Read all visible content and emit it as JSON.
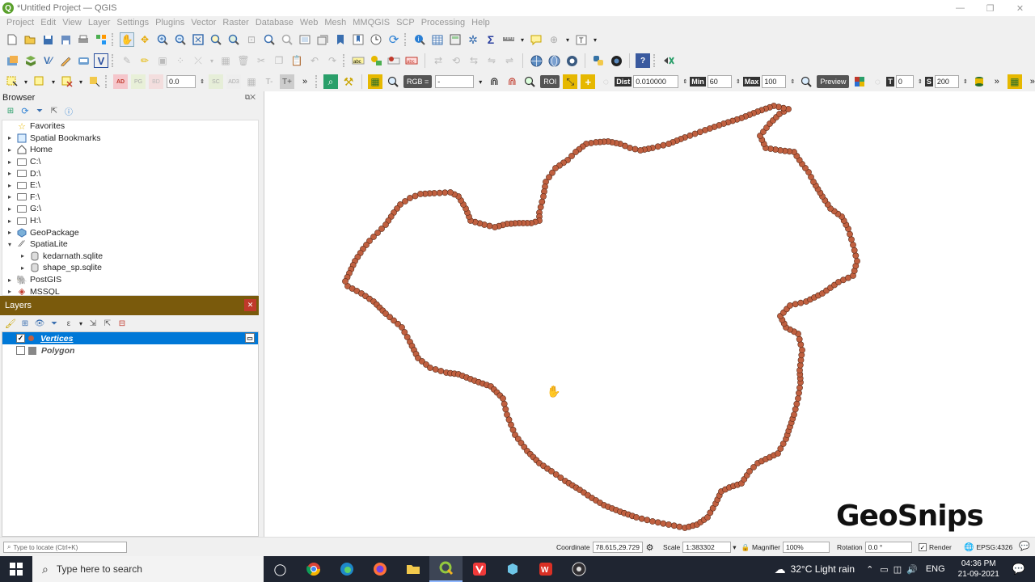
{
  "window": {
    "title": "*Untitled Project — QGIS",
    "app_letter": "Q"
  },
  "menu": [
    "Project",
    "Edit",
    "View",
    "Layer",
    "Settings",
    "Plugins",
    "Vector",
    "Raster",
    "Database",
    "Web",
    "Mesh",
    "MMQGIS",
    "SCP",
    "Processing",
    "Help"
  ],
  "toolbar3": {
    "field_value": "0.0",
    "rgb_label": "RGB =",
    "rgb_value": "-",
    "roi_label": "ROI",
    "dist_label": "Dist",
    "dist_value": "0.010000",
    "min_label": "Min",
    "min_value": "60",
    "max_label": "Max",
    "max_value": "100",
    "preview_label": "Preview",
    "t_label": "T",
    "t_value": "0",
    "s_label": "S",
    "s_value": "200"
  },
  "browser": {
    "title": "Browser",
    "items": [
      {
        "label": "Favorites",
        "icon": "star-icon",
        "arrow": "",
        "indent": 0
      },
      {
        "label": "Spatial Bookmarks",
        "icon": "bookmark-icon",
        "arrow": "▸",
        "indent": 0
      },
      {
        "label": "Home",
        "icon": "home-icon",
        "arrow": "▸",
        "indent": 0
      },
      {
        "label": "C:\\",
        "icon": "folder-icon",
        "arrow": "▸",
        "indent": 0
      },
      {
        "label": "D:\\",
        "icon": "folder-icon",
        "arrow": "▸",
        "indent": 0
      },
      {
        "label": "E:\\",
        "icon": "folder-icon",
        "arrow": "▸",
        "indent": 0
      },
      {
        "label": "F:\\",
        "icon": "folder-icon",
        "arrow": "▸",
        "indent": 0
      },
      {
        "label": "G:\\",
        "icon": "folder-icon",
        "arrow": "▸",
        "indent": 0
      },
      {
        "label": "H:\\",
        "icon": "folder-icon",
        "arrow": "▸",
        "indent": 0
      },
      {
        "label": "GeoPackage",
        "icon": "geopackage-icon",
        "arrow": "▸",
        "indent": 0
      },
      {
        "label": "SpatiaLite",
        "icon": "spatialite-icon",
        "arrow": "▾",
        "indent": 0
      },
      {
        "label": "kedarnath.sqlite",
        "icon": "database-icon",
        "arrow": "▸",
        "indent": 1
      },
      {
        "label": "shape_sp.sqlite",
        "icon": "database-icon",
        "arrow": "▸",
        "indent": 1
      },
      {
        "label": "PostGIS",
        "icon": "postgis-icon",
        "arrow": "▸",
        "indent": 0
      },
      {
        "label": "MSSQL",
        "icon": "mssql-icon",
        "arrow": "▸",
        "indent": 0
      }
    ]
  },
  "layers": {
    "title": "Layers",
    "items": [
      {
        "name": "Vertices",
        "checked": true,
        "selected": true,
        "color": "#c06040"
      },
      {
        "name": "Polygon",
        "checked": false,
        "selected": false,
        "color": "#888888"
      }
    ]
  },
  "status": {
    "locator_placeholder": "Type to locate (Ctrl+K)",
    "coordinate_label": "Coordinate",
    "coordinate_value": "78.615,29.729",
    "scale_label": "Scale",
    "scale_value": "1:383302",
    "magnifier_label": "Magnifier",
    "magnifier_value": "100%",
    "rotation_label": "Rotation",
    "rotation_value": "0.0 °",
    "render_label": "Render",
    "crs_value": "EPSG:4326"
  },
  "taskbar": {
    "search_placeholder": "Type here to search",
    "weather": "32°C  Light rain",
    "language": "ENG",
    "time": "04:36 PM",
    "date": "21-09-2021"
  },
  "watermark": "GeoSnips",
  "colors": {
    "accent": "#0078d7",
    "layers_header": "#7a5a0c",
    "vertex": "#c06040"
  }
}
